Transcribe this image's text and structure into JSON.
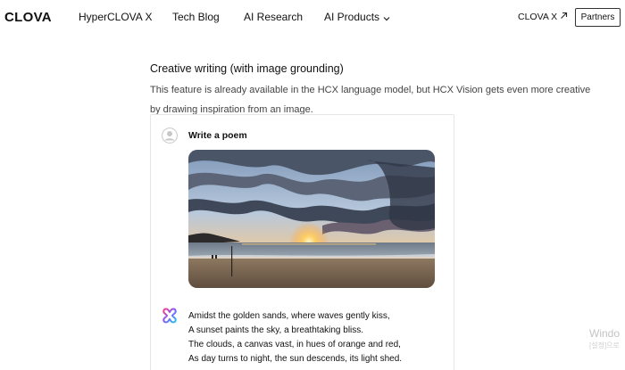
{
  "nav": {
    "logo": "CLOVA",
    "links": [
      "HyperCLOVA X",
      "Tech Blog",
      "AI Research",
      "AI Products"
    ],
    "clova_x": "CLOVA X",
    "partners": "Partners"
  },
  "article": {
    "title": "Creative writing (with image grounding)",
    "description": "This feature is already available in the HCX language model, but HCX Vision gets even more creative by drawing inspiration from an image."
  },
  "chat": {
    "prompt": "Write a poem",
    "image_icon": "sunset-beach-photo",
    "user_icon": "user-avatar-icon",
    "ai_icon": "hcx-logo-icon",
    "poem_lines": [
      "Amidst the golden sands, where waves gently kiss,",
      "A sunset paints the sky, a breathtaking bliss.",
      "The clouds, a canvas vast, in hues of orange and red,",
      "As day turns to night, the sun descends, its light shed."
    ]
  },
  "watermark": {
    "line1": "Windo",
    "line2": "[설정]으로"
  },
  "colors": {
    "text": "#111111",
    "muted": "#444444",
    "card_border": "#e6e6e6",
    "ai_icon_gradient": [
      "#ff3d8a",
      "#7b5cff",
      "#1fc8e8"
    ]
  }
}
